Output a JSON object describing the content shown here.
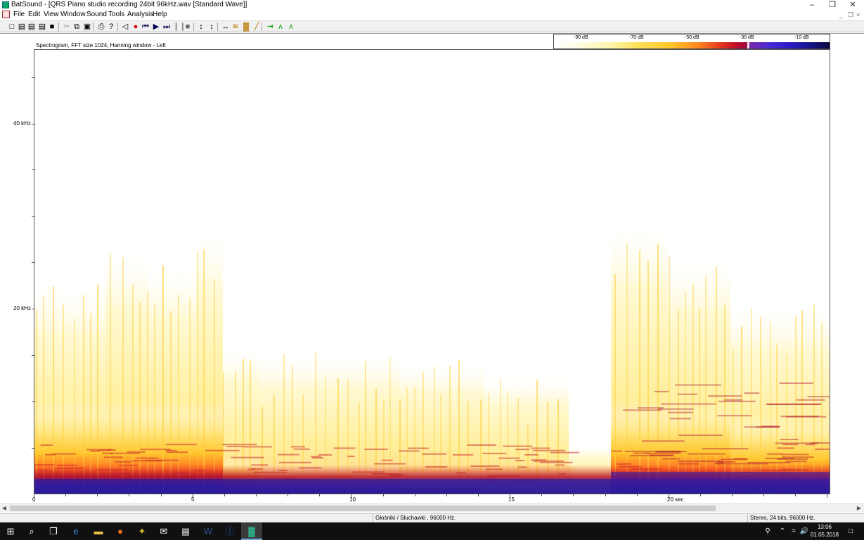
{
  "window": {
    "title": "BatSound - [QRS Piano studio recording 24bit 96kHz.wav [Standard Wave]]",
    "controls": {
      "minimize": "–",
      "restore": "❐",
      "close": "✕"
    }
  },
  "menu": [
    "File",
    "Edit",
    "View",
    "Window",
    "Sound",
    "Tools",
    "Analysis",
    "Help"
  ],
  "mdi_controls": {
    "minimize": "_",
    "restore": "❐",
    "close": "×"
  },
  "toolbar": {
    "buttons": [
      {
        "name": "new-icon",
        "glyph": "□"
      },
      {
        "name": "open-icon",
        "glyph": "▤"
      },
      {
        "name": "open-folder-icon",
        "glyph": "▤"
      },
      {
        "name": "recent-icon",
        "glyph": "▤"
      },
      {
        "name": "save-icon",
        "glyph": "■"
      },
      {
        "name": "cut-icon",
        "glyph": "✂"
      },
      {
        "name": "copy-icon",
        "glyph": "⧉"
      },
      {
        "name": "paste-icon",
        "glyph": "▣"
      },
      {
        "name": "print-icon",
        "glyph": "⎙"
      },
      {
        "name": "help-icon",
        "glyph": "?"
      },
      {
        "name": "speaker-icon",
        "glyph": "◁"
      },
      {
        "name": "record-icon",
        "glyph": "●"
      },
      {
        "name": "rewind-icon",
        "glyph": "⏮"
      },
      {
        "name": "play-icon",
        "glyph": "▶"
      },
      {
        "name": "fast-forward-icon",
        "glyph": "⏭"
      },
      {
        "name": "pause-icon",
        "glyph": "❙❙"
      },
      {
        "name": "stop-icon",
        "glyph": "■"
      },
      {
        "name": "zoom-in-vertical-icon",
        "glyph": "↕"
      },
      {
        "name": "zoom-out-vertical-icon",
        "glyph": "↕"
      },
      {
        "name": "zoom-horizontal-icon",
        "glyph": "↔"
      },
      {
        "name": "oscillogram-icon",
        "glyph": "≋"
      },
      {
        "name": "spectrogram-icon",
        "glyph": "▓"
      },
      {
        "name": "power-spectrum-icon",
        "glyph": "╱"
      },
      {
        "name": "forward-icon",
        "glyph": "⇥"
      },
      {
        "name": "spectrum-green-icon",
        "glyph": "ʌ"
      },
      {
        "name": "spectrum-alt-icon",
        "glyph": "ʌ"
      }
    ]
  },
  "plot": {
    "title": "Spectrogram, FFT size 1024, Hanning window - Left",
    "colorbar_labels": [
      "-90 dB",
      "-70 dB",
      "-50 dB",
      "-30 dB",
      "-10 dB"
    ],
    "y_labels": [
      {
        "text": "40 kHz",
        "khz": 40
      },
      {
        "text": "20 kHz",
        "khz": 20
      }
    ],
    "y_max_khz": 48,
    "x_labels": [
      {
        "text": "0",
        "sec": 0
      },
      {
        "text": "5",
        "sec": 5
      },
      {
        "text": "10",
        "sec": 10
      },
      {
        "text": "15",
        "sec": 15
      },
      {
        "text": "20 sec",
        "sec": 20
      }
    ],
    "x_max_sec": 25.1
  },
  "status": {
    "device": "Głośniki / Słuchawki ,  96000 Hz.",
    "format": "Stereo, 24 bits, 96000 Hz."
  },
  "taskbar": {
    "apps": [
      {
        "name": "start-icon",
        "glyph": "⊞"
      },
      {
        "name": "search-icon",
        "glyph": "⌕"
      },
      {
        "name": "task-view-icon",
        "glyph": "❒"
      },
      {
        "name": "edge-icon",
        "glyph": "e"
      },
      {
        "name": "file-explorer-icon",
        "glyph": "▬"
      },
      {
        "name": "firefox-icon",
        "glyph": "●"
      },
      {
        "name": "app-icon",
        "glyph": "✦"
      },
      {
        "name": "mail-icon",
        "glyph": "✉"
      },
      {
        "name": "calculator-icon",
        "glyph": "▦"
      },
      {
        "name": "word-icon",
        "glyph": "W"
      },
      {
        "name": "info-app-icon",
        "glyph": "ⓘ"
      },
      {
        "name": "batsound-icon",
        "glyph": "▓"
      }
    ],
    "time": "13:06",
    "date": "01.05.2018"
  }
}
